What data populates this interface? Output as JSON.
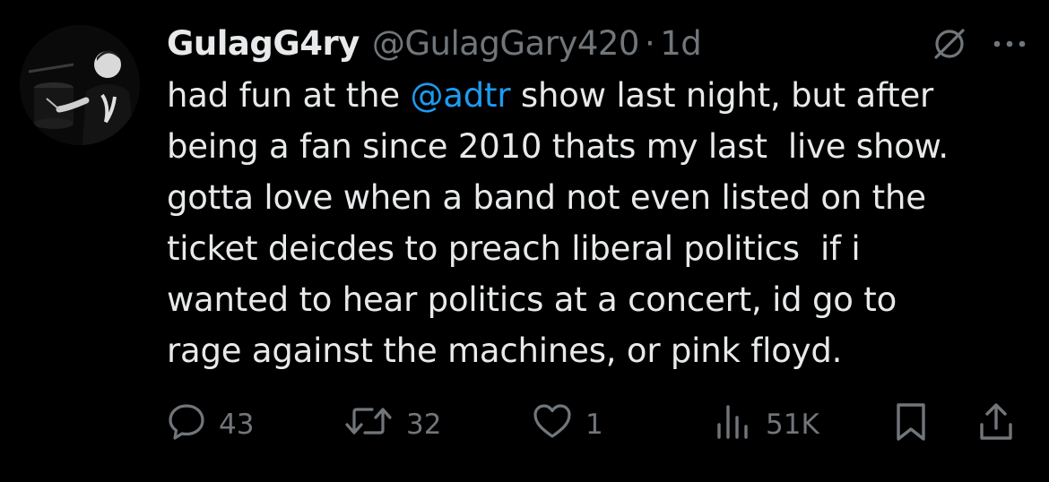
{
  "author": {
    "display_name": "GulagG4ry",
    "handle": "@GulagGary420",
    "separator": "·",
    "time": "1d"
  },
  "tweet": {
    "lines": [
      {
        "before": "had fun at the ",
        "mention": "@adtr",
        "after": " show last night, but after"
      },
      {
        "before": "being a fan since 2010 thats my last  live show.",
        "mention": "",
        "after": ""
      },
      {
        "before": "gotta love when a band not even listed on the",
        "mention": "",
        "after": ""
      },
      {
        "before": "ticket deicdes to preach liberal politics  if i",
        "mention": "",
        "after": ""
      },
      {
        "before": "wanted to hear politics at a concert, id go to",
        "mention": "",
        "after": ""
      },
      {
        "before": "rage against the machines, or pink floyd.",
        "mention": "",
        "after": ""
      }
    ]
  },
  "actions": {
    "reply_count": "43",
    "retweet_count": "32",
    "like_count": "1",
    "view_count": "51K"
  },
  "icons": {
    "header": [
      "grok-icon",
      "more-icon"
    ],
    "actions": [
      "reply-icon",
      "retweet-icon",
      "like-icon",
      "views-icon",
      "bookmark-icon",
      "share-icon"
    ]
  },
  "colors": {
    "background": "#000000",
    "text": "#e7e9ea",
    "muted": "#71767b",
    "link": "#1d9bf0"
  }
}
